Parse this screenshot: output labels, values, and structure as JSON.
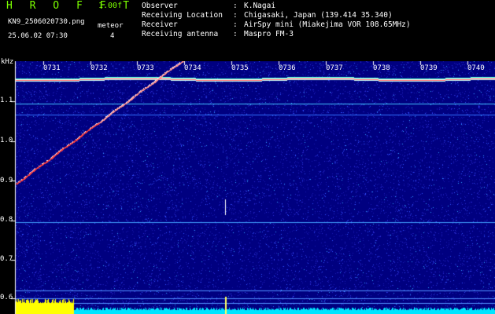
{
  "app": {
    "title": "H R O F F T",
    "version": "1.00f"
  },
  "file": {
    "name": "KN9_2506020730.png",
    "datetime": "25.06.02 07:30"
  },
  "meteor": {
    "label": "meteor",
    "count": "4"
  },
  "info": [
    {
      "key": "Observer",
      "sep": ":",
      "value": "K.Nagai"
    },
    {
      "key": "Receiving Location",
      "sep": ":",
      "value": "Chigasaki, Japan (139.414 35.340)"
    },
    {
      "key": "Receiver",
      "sep": ":",
      "value": "AirSpy mini (Miakejima VOR 108.65MHz)"
    },
    {
      "key": "Receiving antenna",
      "sep": ":",
      "value": "Maspro FM-3"
    }
  ],
  "axis": {
    "unit": "kHz",
    "y_ticks": [
      "1.1",
      "1.0",
      "0.9",
      "0.8",
      "0.7",
      "0.6"
    ],
    "time_ticks": [
      "0731",
      "0732",
      "0733",
      "0734",
      "0735",
      "0736",
      "0737",
      "0738",
      "0739",
      "0740"
    ]
  },
  "colors": {
    "text_accent": "#7cff00",
    "background": "#000080",
    "carrier": "#ff6a6a",
    "noise_bar": "#00e5ff",
    "level_bar": "#ffff00"
  }
}
